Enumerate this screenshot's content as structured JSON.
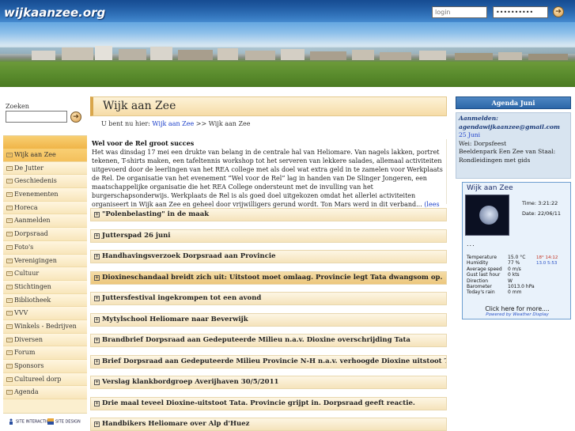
{
  "header": {
    "logo": "wijkaanzee.org",
    "login_placeholder": "login",
    "password_value": "••••••••••"
  },
  "search": {
    "label": "Zoeken"
  },
  "nav": {
    "items": [
      "Wijk aan Zee",
      "De Jutter",
      "Geschiedenis",
      "Evenementen",
      "Horeca",
      "Aanmelden",
      "Dorpsraad",
      "Foto's",
      "Verenigingen",
      "Cultuur",
      "Stichtingen",
      "Bibliotheek",
      "VVV",
      "Winkels - Bedrijven",
      "Diversen",
      "Forum",
      "Sponsors",
      "Cultureel dorp",
      "Agenda"
    ],
    "active_index": 0
  },
  "footer_logos": {
    "left": "SITE INTERACTION",
    "right": "SITE DESIGN"
  },
  "main": {
    "title": "Wijk aan Zee",
    "breadcrumb": {
      "prefix": "U bent nu hier:",
      "link": "Wijk aan Zee",
      "separator": ">>",
      "current": "Wijk aan Zee"
    },
    "article": {
      "title": "Wel voor de Rel groot succes",
      "body": "Het was dinsdag 17 mei een drukte van belang in de centrale hal van Heliomare. Van nagels lakken, portret tekenen, T-shirts maken, een tafeltennis workshop tot het serveren van lekkere salades, allemaal activiteiten uitgevoerd door de leerlingen van het REA college met als doel wat extra geld in te zamelen voor Werkplaats de Rel.   De organisatie van het evenement “Wel voor de Rel” lag in handen van De Slinger Jongeren, een maatschappelijke organisatie die het REA College ondersteunt met de invulling van het burgerschapsonderwijs. Werkplaats de Rel is als goed doel uitgekozen omdat het allerlei activiteiten organiseert in Wijk aan Zee en geheel door vrijwilligers gerund wordt. Ton Mars werd in dit verband...",
      "more": "(lees meer)"
    },
    "items": [
      "\"Polenbelasting\" in de maak",
      "Jutterspad 26 juni",
      "Handhavingsverzoek Dorpsraad aan Provincie",
      "Dioxineschandaal breidt zich uit: Uitstoot moet omlaag. Provincie legt Tata dwangsom op.",
      "Juttersfestival ingekrompen tot een avond",
      "Mytylschool Heliomare naar Beverwijk",
      "Brandbrief Dorpsraad aan Gedeputeerde Milieu n.a.v. Dioxine overschrijding Tata",
      "Brief Dorpsraad aan Gedeputeerde Milieu Provincie N-H n.a.v. verhoogde Dioxine uitstoot Tata",
      "Verslag klankbordgroep Averijhaven 30/5/2011",
      "Drie maal teveel Dioxine-uitstoot Tata. Provincie grijpt in. Dorpsraad geeft reactie.",
      "Handbikers Heliomare over Alp d'Huez"
    ]
  },
  "agenda": {
    "title": "Agenda Juni",
    "line1": "Aanmelden:",
    "line2": "agendawijkaanzee@gmail.com",
    "date": "25 Juni",
    "line3": "Wei: Dorpsfeest",
    "line4": "Beeldenpark Een Zee van Staal:",
    "line5": "Rondleidingen met gids"
  },
  "weather": {
    "title": "Wijk aan Zee",
    "time_label": "Time:",
    "time": "3:21:22",
    "date_label": "Date:",
    "date": "22/06/11",
    "dots": "...",
    "rows": [
      {
        "label": "Temperature",
        "value": "15.0 °C",
        "extra": "18° 14:12",
        "extra_color": "red"
      },
      {
        "label": "Humidity",
        "value": "77 %",
        "extra": "13.0 5:53",
        "extra_color": "blue"
      },
      {
        "label": "Average speed",
        "value": "0 m/s",
        "extra": "",
        "extra_color": ""
      },
      {
        "label": "Gust last hour",
        "value": "0 kts",
        "extra": "",
        "extra_color": ""
      },
      {
        "label": "Direction",
        "value": "W",
        "extra": "",
        "extra_color": ""
      },
      {
        "label": "Barometer",
        "value": "1013.0 hPa",
        "extra": "",
        "extra_color": ""
      },
      {
        "label": "Today's rain",
        "value": "0 mm",
        "extra": "",
        "extra_color": ""
      }
    ],
    "click": "Click here for more....",
    "powered": "Powered by Weather Display"
  },
  "colors": {
    "accent": "#f0b548",
    "link": "#1a3ec9",
    "agenda": "#2d67a8"
  }
}
